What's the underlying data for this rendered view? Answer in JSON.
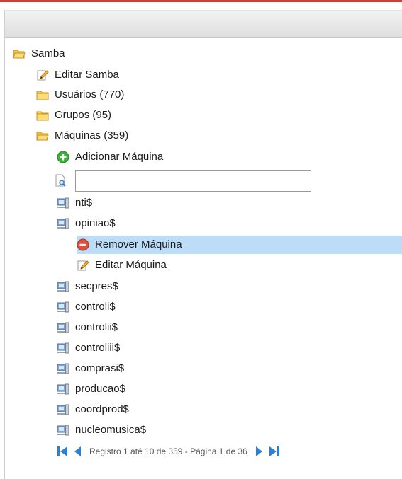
{
  "tree": {
    "root": {
      "label": "Samba",
      "icon": "folder-open-icon"
    },
    "edit_samba": {
      "label": "Editar Samba",
      "icon": "pencil-icon"
    },
    "users": {
      "label": "Usuários (770)",
      "icon": "folder-icon"
    },
    "groups": {
      "label": "Grupos (95)",
      "icon": "folder-icon"
    },
    "machines": {
      "label": "Máquinas (359)",
      "icon": "folder-open-icon"
    },
    "add_machine": {
      "label": "Adicionar Máquina",
      "icon": "add-icon"
    },
    "search": {
      "value": "",
      "placeholder": ""
    },
    "machine_list": [
      {
        "label": "nti$"
      },
      {
        "label": "opiniao$"
      },
      {
        "label": "secpres$"
      },
      {
        "label": "controli$"
      },
      {
        "label": "controlii$"
      },
      {
        "label": "controliii$"
      },
      {
        "label": "comprasi$"
      },
      {
        "label": "producao$"
      },
      {
        "label": "coordprod$"
      },
      {
        "label": "nucleomusica$"
      }
    ],
    "machine_actions": {
      "remove": {
        "label": "Remover Máquina",
        "icon": "remove-icon"
      },
      "edit": {
        "label": "Editar Máquina",
        "icon": "pencil-icon"
      }
    }
  },
  "pager": {
    "text": "Registro 1 até 10 de 359 - Página 1 de 36"
  },
  "colors": {
    "accent_red": "#c9423a",
    "selection": "#bcdcf8",
    "pager_blue": "#2a7fd9"
  }
}
